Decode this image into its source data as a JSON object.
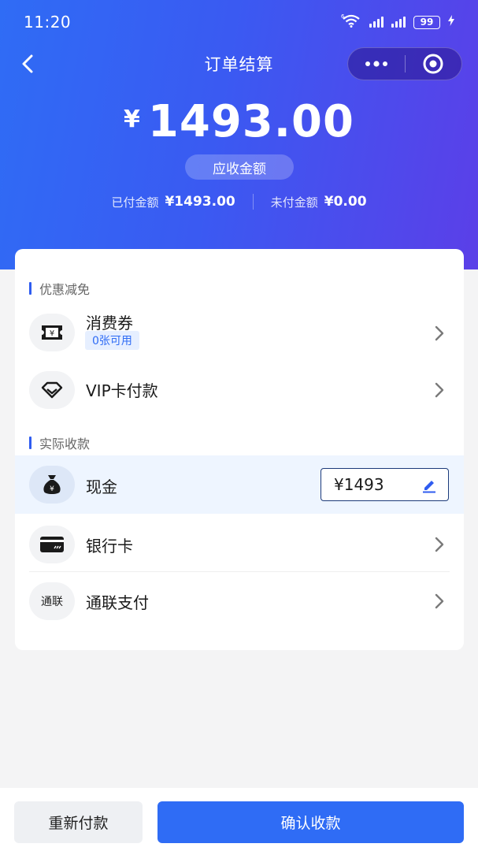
{
  "status_bar": {
    "time": "11:20",
    "network": "6",
    "battery": "99"
  },
  "nav": {
    "title": "订单结算"
  },
  "summary": {
    "currency_symbol": "¥",
    "amount": "1493.00",
    "amount_label": "应收金额",
    "paid_label": "已付金额",
    "paid_value": "¥1493.00",
    "unpaid_label": "未付金额",
    "unpaid_value": "¥0.00"
  },
  "discount_section": {
    "title": "优惠减免",
    "items": [
      {
        "label": "消费券",
        "badge": "0张可用",
        "icon": "coupon-icon"
      },
      {
        "label": "VIP卡付款",
        "icon": "diamond-icon"
      }
    ]
  },
  "payment_section": {
    "title": "实际收款",
    "cash": {
      "label": "现金",
      "value": "¥1493",
      "icon": "money-bag-icon"
    },
    "items": [
      {
        "label": "银行卡",
        "icon": "bank-card-icon"
      },
      {
        "label": "通联支付",
        "icon_text": "通联"
      }
    ]
  },
  "footer": {
    "retry_label": "重新付款",
    "confirm_label": "确认收款"
  },
  "colors": {
    "accent": "#2f6cf5",
    "hero_start": "#2f6cf5",
    "hero_end": "#5b3fe8"
  }
}
